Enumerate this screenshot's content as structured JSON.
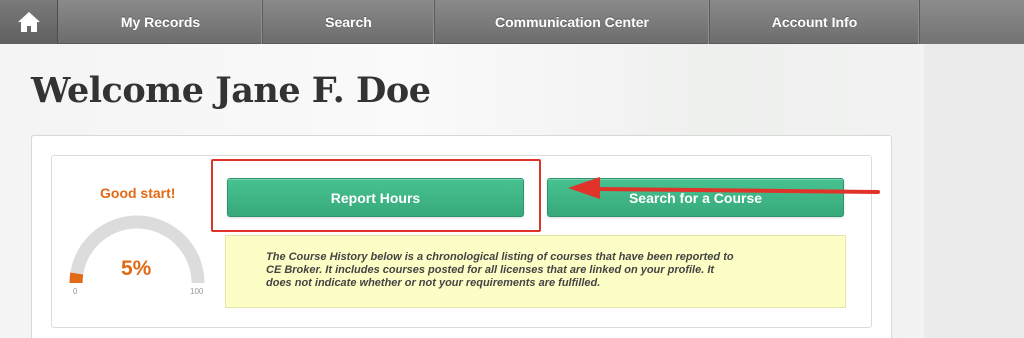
{
  "nav": {
    "home_icon": "home-icon",
    "items": [
      {
        "label": "My Records"
      },
      {
        "label": "Search"
      },
      {
        "label": "Communication Center"
      },
      {
        "label": "Account Info"
      }
    ]
  },
  "welcome": {
    "title": "Welcome Jane F. Doe"
  },
  "progress": {
    "status": "Good start!",
    "percent_label": "5%",
    "percent": 5,
    "min_label": "0",
    "max_label": "100"
  },
  "actions": {
    "report_hours": "Report Hours",
    "search_course": "Search for a Course"
  },
  "info": {
    "lines": [
      "The Course History below is a chronological listing of courses that have been reported to",
      "CE Broker. It includes courses posted for all licenses that are linked on your profile. It",
      "does not indicate whether or not your requirements are fulfilled."
    ]
  },
  "colors": {
    "accent_green": "#3fb886",
    "status_orange": "#e06a16",
    "annotation_red": "#e0332a",
    "info_bg": "#fdfdc6"
  }
}
